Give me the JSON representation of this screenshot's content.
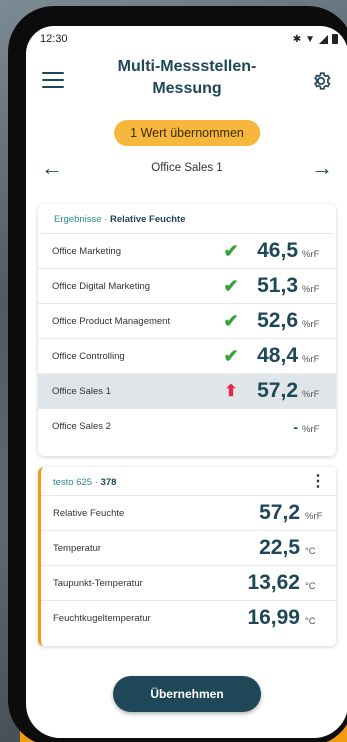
{
  "status_bar": {
    "time": "12:30"
  },
  "app_bar": {
    "title": "Multi-Messstellen-Messung"
  },
  "banner": {
    "text": "1 Wert übernommen"
  },
  "nav": {
    "current": "Office Sales 1"
  },
  "results": {
    "header_label": "Ergebnisse",
    "header_separator": "·",
    "header_value": "Relative Feuchte",
    "rows": [
      {
        "name": "Office Marketing",
        "status_icon": "check-icon",
        "value": "46,5",
        "unit": "%rF"
      },
      {
        "name": "Office Digital Marketing",
        "status_icon": "check-icon",
        "value": "51,3",
        "unit": "%rF"
      },
      {
        "name": "Office Product Management",
        "status_icon": "check-icon",
        "value": "52,6",
        "unit": "%rF"
      },
      {
        "name": "Office Controlling",
        "status_icon": "check-icon",
        "value": "48,4",
        "unit": "%rF"
      },
      {
        "name": "Office Sales 1",
        "status_icon": "arrow-up-icon",
        "value": "57,2",
        "unit": "%rF"
      },
      {
        "name": "Office Sales 2",
        "status_icon": "dash-icon",
        "value": "-",
        "unit": "%rF"
      }
    ]
  },
  "device": {
    "model": "testo 625",
    "separator": "·",
    "serial": "378",
    "rows": [
      {
        "name": "Relative Feuchte",
        "value": "57,2",
        "unit": "%rF"
      },
      {
        "name": "Temperatur",
        "value": "22,5",
        "unit": "°C"
      },
      {
        "name": "Taupunkt-Temperatur",
        "value": "13,62",
        "unit": "°C"
      },
      {
        "name": "Feuchtkugeltemperatur",
        "value": "16,99",
        "unit": "°C"
      }
    ]
  },
  "actions": {
    "apply_label": "Übernehmen"
  },
  "colors": {
    "primary": "#1e4757",
    "accent": "#f39c12",
    "banner": "#f6b73c",
    "ok": "#3aa13a",
    "alert": "#e8254a",
    "teal": "#2e8b8b"
  }
}
